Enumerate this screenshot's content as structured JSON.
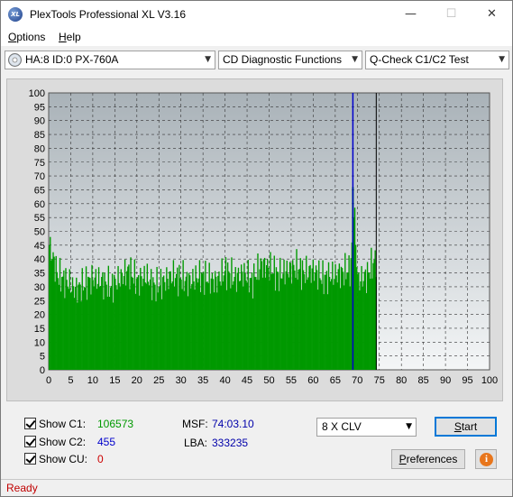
{
  "window": {
    "title": "PlexTools Professional XL V3.16",
    "icon_text": "XL"
  },
  "menu": [
    {
      "label_u": "O",
      "label_rest": "ptions"
    },
    {
      "label_u": "H",
      "label_rest": "elp"
    }
  ],
  "toolbar": {
    "drive": "HA:8 ID:0  PX-760A",
    "function": "CD Diagnostic Functions",
    "test": "Q-Check C1/C2 Test"
  },
  "chart_data": {
    "type": "bar",
    "x_ticks": [
      0,
      5,
      10,
      15,
      20,
      25,
      30,
      35,
      40,
      45,
      50,
      55,
      60,
      65,
      70,
      75,
      80,
      85,
      90,
      95,
      100
    ],
    "y_ticks": [
      0,
      5,
      10,
      15,
      20,
      25,
      30,
      35,
      40,
      45,
      50,
      55,
      60,
      65,
      70,
      75,
      80,
      85,
      90,
      95,
      100
    ],
    "xlim": [
      0,
      100
    ],
    "ylim": [
      0,
      100
    ],
    "grid": true,
    "series": [
      {
        "values_note_free": true,
        "x": [
          0,
          2,
          4,
          6,
          8,
          10,
          12,
          14,
          16,
          18,
          20,
          22,
          24,
          26,
          28,
          30,
          32,
          34,
          36,
          38,
          40,
          42,
          44,
          46,
          48,
          50,
          52,
          54,
          56,
          58,
          60,
          62,
          64,
          66,
          68,
          68.5,
          69,
          70,
          72,
          74
        ],
        "y": [
          49,
          38,
          36,
          33,
          35,
          37,
          36,
          34,
          37,
          40,
          36,
          38,
          34,
          36,
          38,
          37,
          36,
          38,
          37,
          36,
          40,
          37,
          39,
          36,
          42,
          41,
          38,
          40,
          41,
          39,
          40,
          37,
          38,
          39,
          40,
          42,
          66,
          36,
          38,
          44
        ],
        "color": "#009900"
      }
    ],
    "current_position_x": 69,
    "end_marker_x": 74.3,
    "colors": {
      "plot_bg_top": "#a9b2b8",
      "plot_bg_bottom": "#f4f6f7",
      "bars": "#009900",
      "position_line": "#0000cc",
      "end_line": "#000000"
    }
  },
  "results": {
    "show_c1_label": "Show C1:",
    "c1_value": "106573",
    "c1_color": "#009900",
    "show_c2_label": "Show C2:",
    "c2_value": "455",
    "c2_color": "#0000cc",
    "show_cu_label": "Show CU:",
    "cu_value": "0",
    "cu_color": "#cc0000",
    "msf_label": "MSF:",
    "msf_value": "74:03.10",
    "lba_label": "LBA:",
    "lba_value": "333235"
  },
  "controls": {
    "speed": "8 X CLV",
    "start_u": "S",
    "start_rest": "tart",
    "pref_u": "P",
    "pref_rest": "references",
    "info_icon": "i"
  },
  "status": {
    "text": "Ready"
  }
}
